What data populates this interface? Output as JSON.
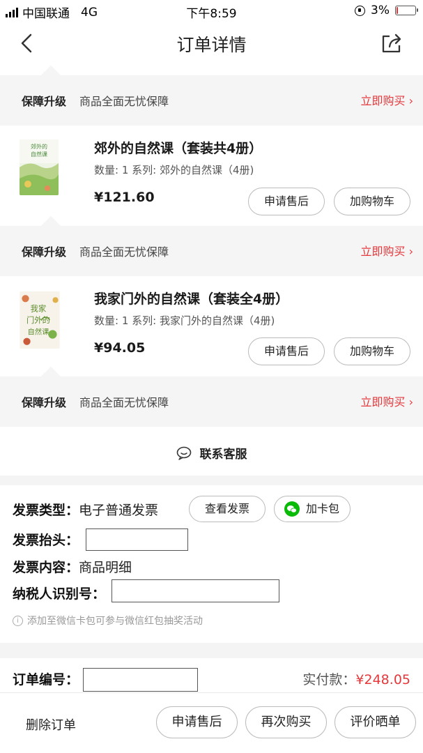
{
  "status_bar": {
    "carrier": "中国联通",
    "network": "4G",
    "time": "下午8:59",
    "battery": "3%",
    "battery_level": 0.03,
    "battery_color": "#e33333"
  },
  "nav": {
    "title": "订单详情",
    "back_icon": "chevron-left-icon",
    "share_icon": "share-icon"
  },
  "guarantee": {
    "title": "保障升级",
    "desc": "商品全面无忧保障",
    "buy": "立即购买 ›"
  },
  "products": [
    {
      "cover_text": "郊外的自然课",
      "title": "郊外的自然课（套装共4册）",
      "meta": "数量: 1 系列: 郊外的自然课（4册)",
      "price": "¥121.60",
      "after_sale": "申请售后",
      "add_cart": "加购物车"
    },
    {
      "cover_text": "我家门外的自然课",
      "title": "我家门外的自然课（套装全4册）",
      "meta": "数量: 1 系列: 我家门外的自然课（4册)",
      "price": "¥94.05",
      "after_sale": "申请售后",
      "add_cart": "加购物车"
    }
  ],
  "service": {
    "label": "联系客服",
    "icon": "chat-bubble-icon"
  },
  "invoice": {
    "type_label": "发票类型：",
    "type_value": "电子普通发票",
    "view_button": "查看发票",
    "card_button": "加卡包",
    "header_label": "发票抬头：",
    "content_label": "发票内容：",
    "content_value": "商品明细",
    "taxid_label": "纳税人识别号：",
    "hint": "添加至微信卡包可参与微信红包抽奖活动"
  },
  "order": {
    "number_label": "订单编号：",
    "paid_label": "实付款：",
    "paid_value": "¥248.05"
  },
  "bottom": {
    "delete": "删除订单",
    "after_sale": "申请售后",
    "rebuy": "再次购买",
    "review": "评价晒单"
  },
  "colors": {
    "accent_red": "#e4393c",
    "wechat_green": "#09bb07",
    "section_bg": "#f5f5f5"
  }
}
